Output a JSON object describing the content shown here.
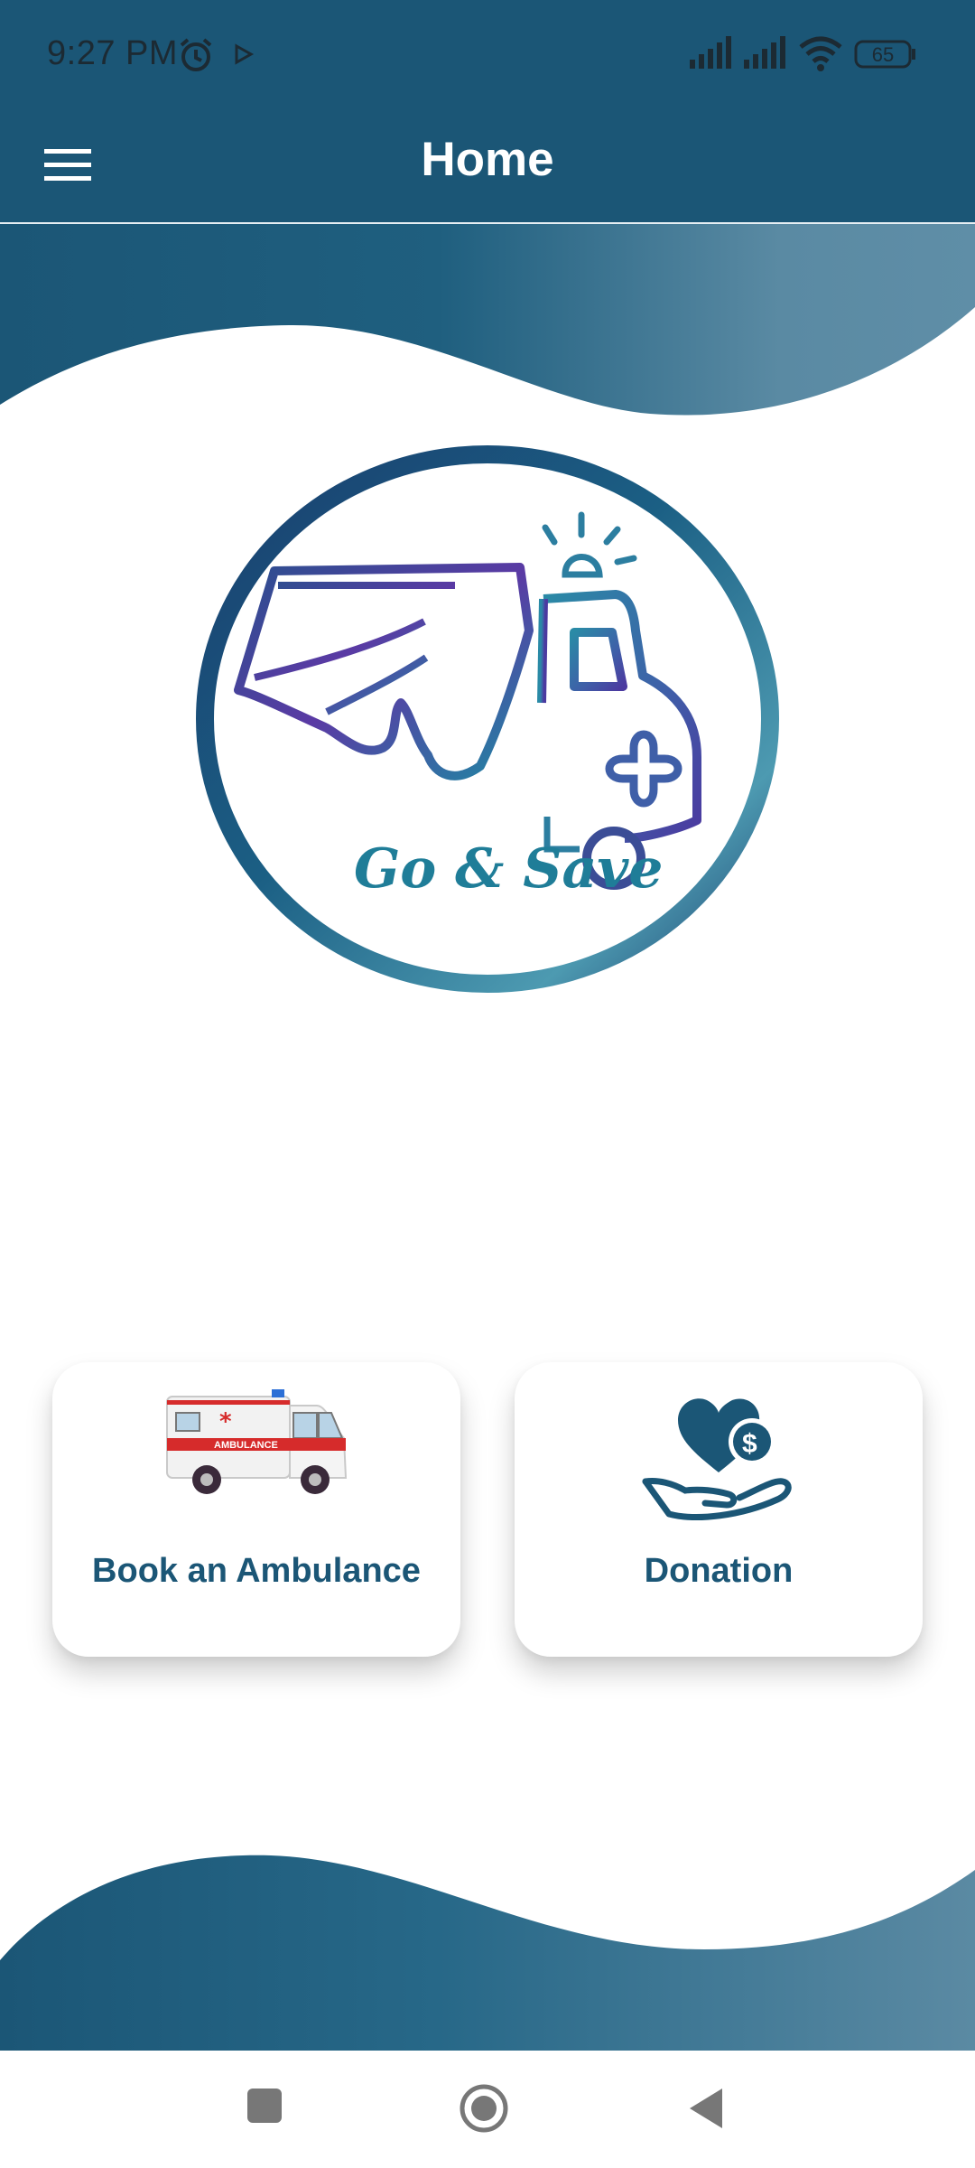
{
  "status_bar": {
    "time": "9:27 PM",
    "battery_level": "65",
    "icons": [
      "alarm-icon",
      "play-icon",
      "signal-icon",
      "signal-icon",
      "wifi-icon",
      "battery-icon"
    ]
  },
  "app_bar": {
    "title": "Home",
    "menu_icon": "hamburger-menu-icon"
  },
  "logo": {
    "text": "Go & Save",
    "icon": "winged-ambulance-logo"
  },
  "cards": [
    {
      "label": "Book an Ambulance",
      "icon": "ambulance-icon"
    },
    {
      "label": "Donation",
      "icon": "donation-hand-heart-icon"
    }
  ],
  "nav_bar": {
    "icons": [
      "recent-apps-icon",
      "home-icon",
      "back-icon"
    ]
  },
  "colors": {
    "primary": "#1b5676",
    "wave_light": "#5b8aa3",
    "label": "#1b5676"
  }
}
